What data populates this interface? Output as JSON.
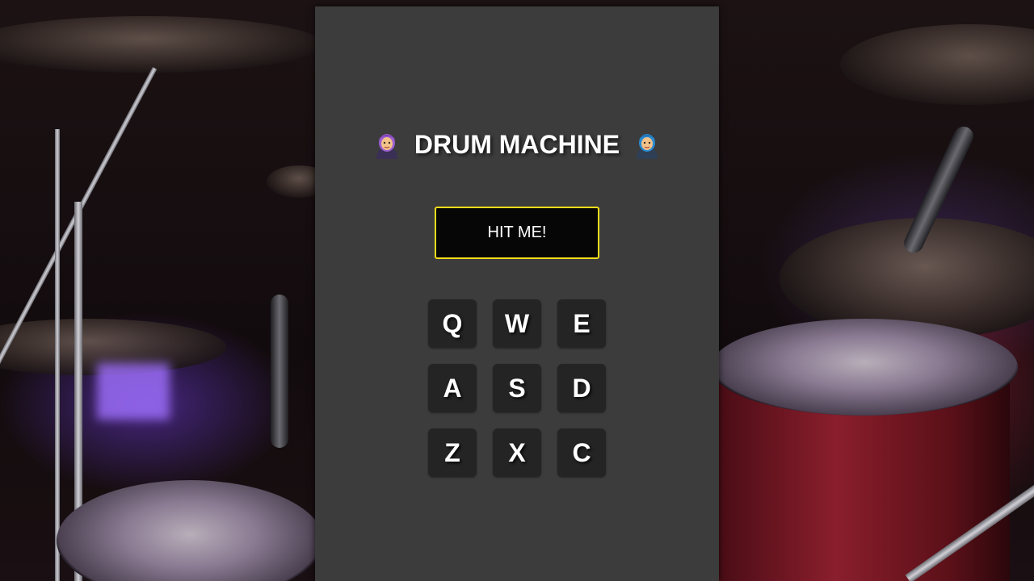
{
  "app": {
    "title": "DRUM MACHINE",
    "left_emoji": "woman-mage-emoji-icon",
    "right_emoji": "man-mage-emoji-icon"
  },
  "display": {
    "label": "HIT ME!",
    "border_color": "#f5dd1a"
  },
  "pads": [
    {
      "key": "Q"
    },
    {
      "key": "W"
    },
    {
      "key": "E"
    },
    {
      "key": "A"
    },
    {
      "key": "S"
    },
    {
      "key": "D"
    },
    {
      "key": "Z"
    },
    {
      "key": "X"
    },
    {
      "key": "C"
    }
  ],
  "colors": {
    "panel": "#3c3c3c",
    "pad": "#242424",
    "display_bg": "#060606",
    "text": "#ffffff"
  }
}
